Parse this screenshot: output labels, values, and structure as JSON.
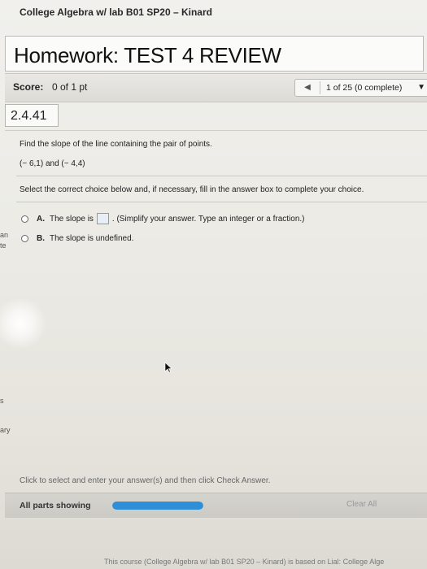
{
  "course": {
    "title": "College Algebra w/ lab B01 SP20 – Kinard"
  },
  "homework": {
    "title": "Homework: TEST 4 REVIEW"
  },
  "score": {
    "label": "Score:",
    "value": "0 of 1 pt"
  },
  "navigation": {
    "position_text": "1 of 25 (0 complete)",
    "prev_icon": "left-triangle-icon",
    "dropdown_icon": "down-triangle-icon"
  },
  "question": {
    "number": "2.4.41",
    "prompt": "Find the slope of the line containing the pair of points.",
    "points": "(− 6,1) and (− 4,4)",
    "instruction": "Select the correct choice below and, if necessary, fill in the answer box to complete your choice.",
    "choices": [
      {
        "letter": "A.",
        "pre": "The slope is",
        "post": ". (Simplify your answer. Type an integer or a fraction.)",
        "answer_value": ""
      },
      {
        "letter": "B.",
        "text": "The slope is undefined."
      }
    ]
  },
  "side_fragments": {
    "a": "an",
    "b": "te",
    "c": "s",
    "d": "ary"
  },
  "footer_actions": {
    "instructions": "Click to select and enter your answer(s) and then click Check Answer.",
    "all_parts_label": "All parts showing",
    "progress_fraction": 1.0,
    "clear_all_label": "Clear All"
  },
  "footer": {
    "text": "This course (College Algebra w/ lab B01 SP20 – Kinard) is based on Lial: College Alge"
  },
  "colors": {
    "progress": "#2f8fd6",
    "accent_border": "#b5b5b0"
  }
}
